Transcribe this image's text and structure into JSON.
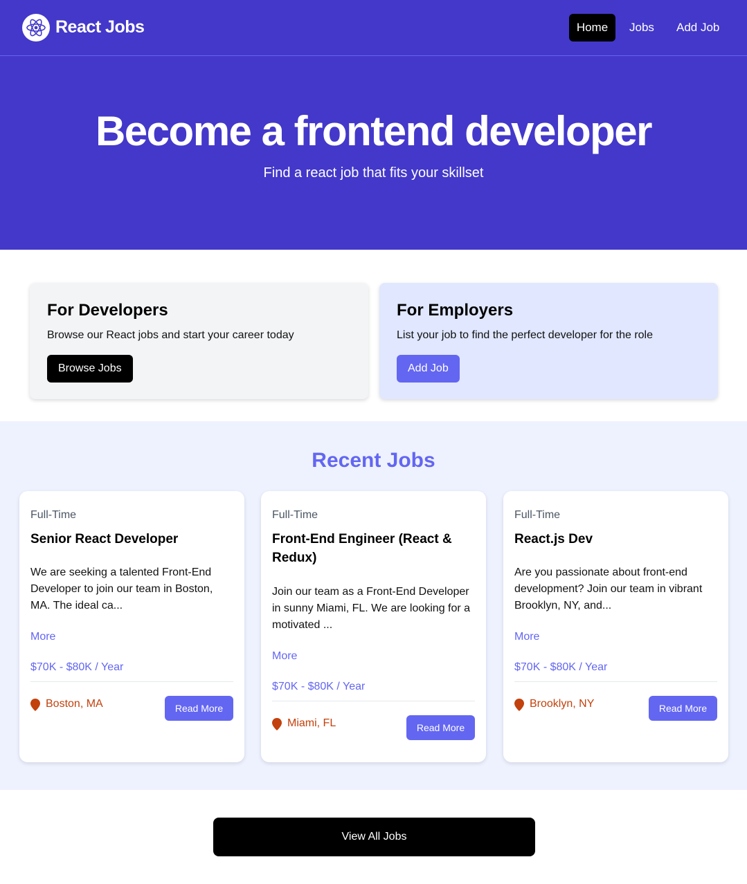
{
  "nav": {
    "brand": "React Jobs",
    "logo_icon": "react-atom-icon",
    "links": [
      "Home",
      "Jobs",
      "Add Job"
    ]
  },
  "hero": {
    "title": "Become a frontend developer",
    "subtitle": "Find a react job that fits your skillset"
  },
  "cards": {
    "developers": {
      "title": "For Developers",
      "text": "Browse our React jobs and start your career today",
      "button": "Browse Jobs"
    },
    "employers": {
      "title": "For Employers",
      "text": "List your job to find the perfect developer for the role",
      "button": "Add Job"
    }
  },
  "recent": {
    "title": "Recent Jobs",
    "jobs": [
      {
        "type": "Full-Time",
        "title": "Senior React Developer",
        "description": "We are seeking a talented Front-End Developer to join our team in Boston, MA. The ideal ca...",
        "more": "More",
        "salary": "$70K - $80K / Year",
        "location": "Boston, MA",
        "button": "Read More"
      },
      {
        "type": "Full-Time",
        "title": "Front-End Engineer (React & Redux)",
        "description": "Join our team as a Front-End Developer in sunny Miami, FL. We are looking for a motivated ...",
        "more": "More",
        "salary": "$70K - $80K / Year",
        "location": "Miami, FL",
        "button": "Read More"
      },
      {
        "type": "Full-Time",
        "title": "React.js Dev",
        "description": "Are you passionate about front-end development? Join our team in vibrant Brooklyn, NY, and...",
        "more": "More",
        "salary": "$70K - $80K / Year",
        "location": "Brooklyn, NY",
        "button": "Read More"
      }
    ]
  },
  "view_all": "View All Jobs",
  "colors": {
    "primary": "#4338ca",
    "accent": "#6366f1",
    "location": "#c2410c"
  }
}
